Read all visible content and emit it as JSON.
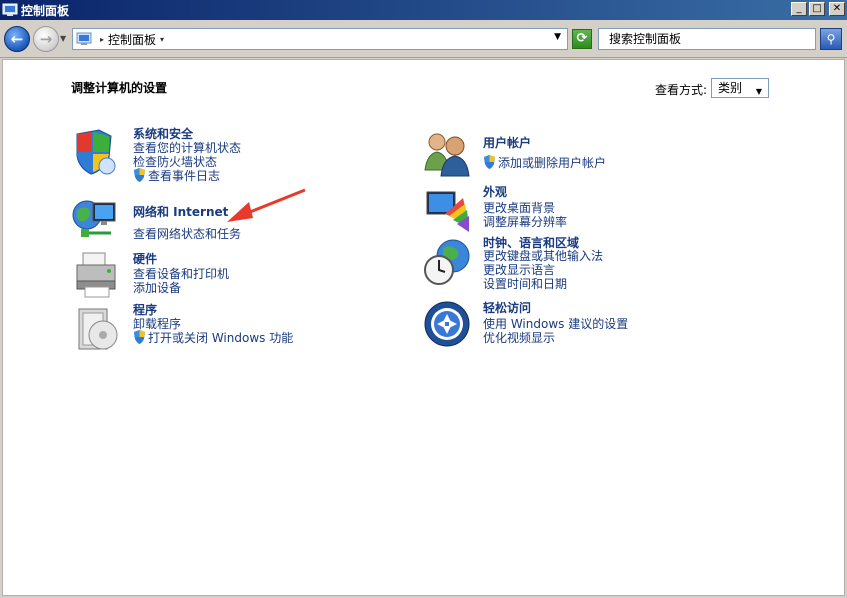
{
  "window": {
    "title": "控制面板",
    "buttons": {
      "minimize": "_",
      "maximize": "□",
      "close": "✕"
    }
  },
  "nav": {
    "breadcrumb": "控制面板",
    "search_placeholder": "搜索控制面板"
  },
  "page": {
    "heading": "调整计算机的设置",
    "view_by_label": "查看方式:",
    "view_by_value": "类别"
  },
  "categories": {
    "system_security": {
      "title": "系统和安全",
      "links": [
        "查看您的计算机状态",
        "检查防火墙状态",
        "查看事件日志"
      ]
    },
    "network": {
      "title": "网络和 Internet",
      "links": [
        "查看网络状态和任务"
      ]
    },
    "hardware": {
      "title": "硬件",
      "links": [
        "查看设备和打印机",
        "添加设备"
      ]
    },
    "programs": {
      "title": "程序",
      "links": [
        "卸载程序",
        "打开或关闭 Windows 功能"
      ]
    },
    "user_accounts": {
      "title": "用户帐户",
      "links": [
        "添加或删除用户帐户"
      ]
    },
    "appearance": {
      "title": "外观",
      "links": [
        "更改桌面背景",
        "调整屏幕分辨率"
      ]
    },
    "clock_region": {
      "title": "时钟、语言和区域",
      "links": [
        "更改键盘或其他输入法",
        "更改显示语言",
        "设置时间和日期"
      ]
    },
    "ease_access": {
      "title": "轻松访问",
      "links": [
        "使用 Windows 建议的设置",
        "优化视频显示"
      ]
    }
  },
  "colors": {
    "link": "#1a3b80",
    "annotation_arrow": "#e8392c",
    "titlebar": "#0a246a"
  }
}
